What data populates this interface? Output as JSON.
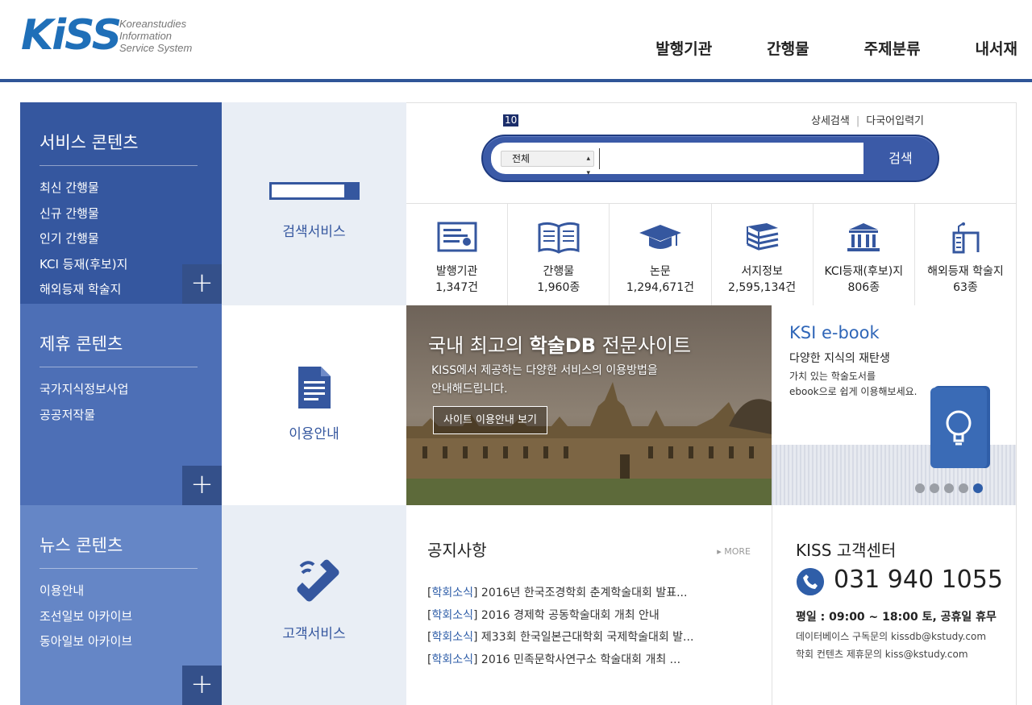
{
  "header": {
    "logo_text": "KiSS",
    "logo_sub": [
      "Koreanstudies",
      "Information",
      "Service System"
    ],
    "nav": [
      "발행기관",
      "간행물",
      "주제분류",
      "내서재"
    ]
  },
  "sidebar": {
    "sections": [
      {
        "title": "서비스 콘텐츠",
        "items": [
          "최신 간행물",
          "신규 간행물",
          "인기 간행물",
          "KCI 등재(후보)지",
          "해외등재 학술지"
        ]
      },
      {
        "title": "제휴 콘텐츠",
        "items": [
          "국가지식정보사업",
          "공공저작물"
        ]
      },
      {
        "title": "뉴스 콘텐츠",
        "items": [
          "이용안내",
          "조선일보 아카이브",
          "동아일보 아카이브"
        ]
      }
    ],
    "plus": "+"
  },
  "tiles": {
    "search_service": "검색서비스",
    "usage_guide": "이용안내",
    "customer_service": "고객서비스"
  },
  "search": {
    "tag": "10",
    "advanced": "상세검색",
    "multilang": "다국어입력기",
    "scope_selected": "전체",
    "button": "검색",
    "value": ""
  },
  "stats": [
    {
      "name": "발행기관",
      "count": "1,347건",
      "icon": "certificate-icon"
    },
    {
      "name": "간행물",
      "count": "1,960종",
      "icon": "open-book-icon"
    },
    {
      "name": "논문",
      "count": "1,294,671건",
      "icon": "graduation-cap-icon"
    },
    {
      "name": "서지정보",
      "count": "2,595,134건",
      "icon": "book-stack-icon"
    },
    {
      "name": "KCI등재(후보)지",
      "count": "806종",
      "icon": "institution-icon"
    },
    {
      "name": "해외등재 학술지",
      "count": "63종",
      "icon": "desk-lamp-icon"
    }
  ],
  "banner": {
    "title_prefix": "국내 최고의 ",
    "title_bold": "학술DB",
    "title_suffix": " 전문사이트",
    "desc_line1": "KISS에서 제공하는 다양한 서비스의 이용방법을",
    "desc_line2": "안내해드립니다.",
    "button": "사이트 이용안내 보기"
  },
  "ebook": {
    "title": "KSI e-book",
    "subtitle": "다양한 지식의 재탄생",
    "desc_line1": "가치 있는 학술도서를",
    "desc_line2": "ebook으로 쉽게 이용해보세요.",
    "slides": 5,
    "active_slide": 5
  },
  "notice": {
    "title": "공지사항",
    "more": "▸ MORE",
    "items": [
      {
        "cat": "학회소식",
        "text": "2016년 한국조경학회 춘계학술대회 발표..."
      },
      {
        "cat": "학회소식",
        "text": "2016 경제학 공동학술대회 개최 안내"
      },
      {
        "cat": "학회소식",
        "text": "제33회 한국일본근대학회 국제학술대회 발..."
      },
      {
        "cat": "학회소식",
        "text": "2016 민족문학사연구소 학술대회 개최 ..."
      }
    ]
  },
  "customer_center": {
    "title": "KISS 고객센터",
    "phone": "031 940 1055",
    "hours": "평일 : 09:00 ~ 18:00 토, 공휴일 휴무",
    "mail1": "데이터베이스 구독문의 kissdb@kstudy.com",
    "mail2": "학회 컨텐츠 제휴문의 kiss@kstudy.com"
  },
  "colors": {
    "primary": "#35579f",
    "accent": "#2f5ea8",
    "sidebar2": "#4d6fb6",
    "sidebar3": "#6586c6"
  }
}
